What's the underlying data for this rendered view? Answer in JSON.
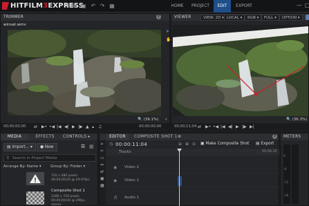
{
  "app": {
    "logo_part1": "HITFILM",
    "logo_part2": "3",
    "logo_part3": "EXPRESS",
    "menu_file": "File"
  },
  "nav": {
    "home": "HOME",
    "project": "PROJECT",
    "edit": "EDIT",
    "export": "EXPORT"
  },
  "trimmer": {
    "title": "TRIMMER",
    "filename": "winsat.wmv",
    "zoom": "(39.1%)",
    "timecode_left": "00;00;00;00",
    "timecode_right": "00;00;00;00"
  },
  "viewer": {
    "title": "VIEWER",
    "view_dd": "VIEW: 2D",
    "local_dd": "LOCAL",
    "rgb_dd": "RGB",
    "full_dd": "FULL",
    "options_dd": "OPTION",
    "zoom": "(36.3%)",
    "timecode_left": "00;00;11;04"
  },
  "media": {
    "tab_media": "MEDIA",
    "tab_effects": "EFFECTS",
    "tab_controls": "CONTROLS",
    "import_label": "Import...",
    "new_label": "New",
    "search_placeholder": "Search in Project Media",
    "arrange_label": "Arrange By: Name",
    "group_label": "Group By: Folder",
    "items": [
      {
        "name": "",
        "info1": "720 x 480 pixels",
        "info2": "00;00;00;00 @ 29.97fps"
      },
      {
        "name": "Composite Shot 1",
        "info1": "1280 x 720 pixels",
        "info2": "00;00;00;00 @ 29fps, stereo"
      }
    ]
  },
  "editor": {
    "tab_editor": "EDITOR",
    "tab_composite": "COMPOSITE SHOT 1",
    "timecode": "00:00:11:04",
    "make_composite": "Make Composite Shot",
    "export_label": "Export",
    "tracks_label": "Tracks",
    "ruler_time": "00;00;10",
    "video2": "Video 2",
    "video1": "Video 1",
    "audio1": "Audio 1"
  },
  "meters": {
    "title": "METERS",
    "ticks": [
      "0",
      "-6",
      "-12",
      "-18"
    ]
  },
  "colors": {
    "accent": "#1f4f8a",
    "brand_red": "#c8202c",
    "playhead": "#c8202c"
  }
}
